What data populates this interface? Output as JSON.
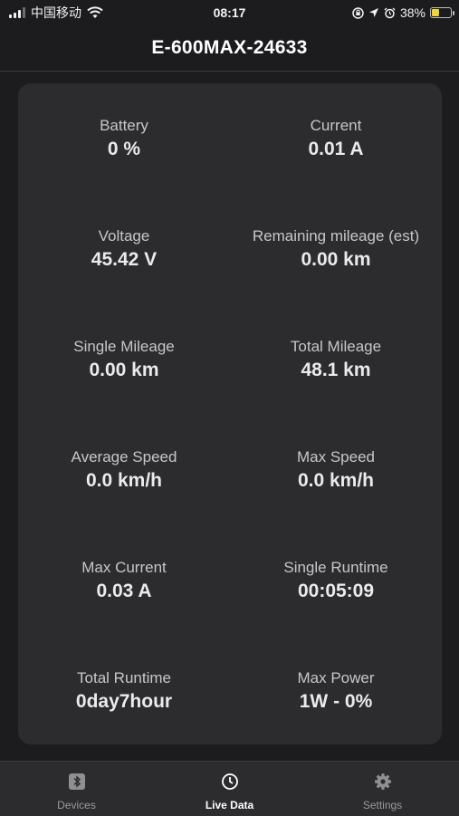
{
  "status_bar": {
    "carrier": "中国移动",
    "time": "08:17",
    "battery_percent": "38%",
    "battery_level": 0.38,
    "icons": [
      "signal-icon",
      "wifi-icon",
      "orientation-lock-icon",
      "location-arrow-icon",
      "alarm-icon",
      "battery-charging-icon"
    ]
  },
  "header": {
    "title": "E-600MAX-24633"
  },
  "metrics": [
    {
      "label": "Battery",
      "value": "0 %"
    },
    {
      "label": "Current",
      "value": "0.01 A"
    },
    {
      "label": "Voltage",
      "value": "45.42 V"
    },
    {
      "label": "Remaining mileage (est)",
      "value": "0.00 km"
    },
    {
      "label": "Single Mileage",
      "value": "0.00 km"
    },
    {
      "label": "Total Mileage",
      "value": "48.1 km"
    },
    {
      "label": "Average Speed",
      "value": "0.0 km/h"
    },
    {
      "label": "Max Speed",
      "value": "0.0 km/h"
    },
    {
      "label": "Max Current",
      "value": "0.03 A"
    },
    {
      "label": "Single Runtime",
      "value": "00:05:09"
    },
    {
      "label": "Total Runtime",
      "value": "0day7hour"
    },
    {
      "label": "Max Power",
      "value": "1W - 0%"
    }
  ],
  "tabs": [
    {
      "label": "Devices",
      "icon": "bluetooth-icon",
      "active": false
    },
    {
      "label": "Live Data",
      "icon": "clock-icon",
      "active": true
    },
    {
      "label": "Settings",
      "icon": "gear-icon",
      "active": false
    }
  ],
  "colors": {
    "background": "#1c1c1e",
    "card": "#2c2c2e",
    "battery_fill": "#f0d43a"
  }
}
